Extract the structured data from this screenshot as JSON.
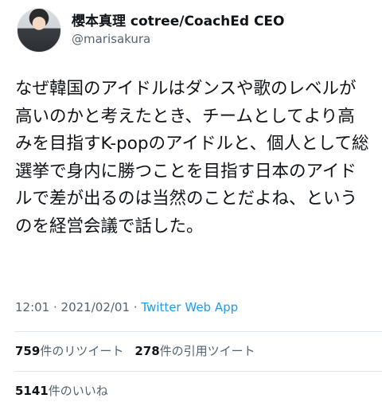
{
  "author": {
    "display_name": "櫻本真理 cotree/CoachEd CEO",
    "handle": "@marisakura"
  },
  "tweet": {
    "text": "なぜ韓国のアイドルはダンスや歌のレベルが高いのかと考えたとき、チームとしてより高みを目指すK-popのアイドルと、個人として総選挙で身内に勝つことを目指す日本のアイドルで差が出るのは当然のことだよね、というのを経営会議で話した。",
    "time": "12:01",
    "separator1": " · ",
    "date": "2021/02/01",
    "separator2": " · ",
    "source": "Twitter Web App"
  },
  "stats": {
    "retweets": {
      "count": "759",
      "label": "件のリツイート"
    },
    "quotes": {
      "count": "278",
      "label": "件の引用ツイート"
    },
    "likes": {
      "count": "5141",
      "label": "件のいいね"
    }
  }
}
